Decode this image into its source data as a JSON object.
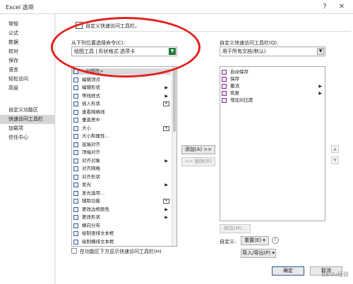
{
  "window": {
    "title": "Excel 选项",
    "help": "?",
    "close": "✕"
  },
  "nav": [
    {
      "label": "常规"
    },
    {
      "label": "公式"
    },
    {
      "label": "数据"
    },
    {
      "label": "校对"
    },
    {
      "label": "保存"
    },
    {
      "label": "语言"
    },
    {
      "label": "轻松访问"
    },
    {
      "label": "高级"
    },
    {
      "label": "自定义功能区"
    },
    {
      "label": "快速访问工具栏"
    },
    {
      "label": "加载项"
    },
    {
      "label": "信任中心"
    }
  ],
  "section": {
    "header": "自定义快速访问工具栏。",
    "choose_label": "从下列位置选择命令(C):",
    "choose_value": "绘图工具 | 形状格式 选项卡",
    "customize_label": "自定义快速访问工具栏(Q):",
    "customize_value": "用于所有文档(默认)"
  },
  "commands": [
    {
      "label": "<分隔符>",
      "icon": "separator-icon"
    },
    {
      "label": "编辑顶点",
      "icon": "edit-points-icon"
    },
    {
      "label": "编辑形状",
      "icon": "edit-shape-icon",
      "arrow": true
    },
    {
      "label": "等线样式",
      "icon": "line-style-icon",
      "arrow": true
    },
    {
      "label": "插入形状",
      "icon": "insert-shape-icon",
      "mini": true
    },
    {
      "label": "查看网格线",
      "icon": "gridlines-icon"
    },
    {
      "label": "垂直居中",
      "icon": "align-middle-icon"
    },
    {
      "label": "大小",
      "icon": "size-icon",
      "mini": true
    },
    {
      "label": "大小和属性...",
      "icon": "size-props-icon"
    },
    {
      "label": "底端对齐",
      "icon": "align-bottom-icon"
    },
    {
      "label": "顶端对齐",
      "icon": "align-top-icon"
    },
    {
      "label": "对齐对象",
      "icon": "align-objects-icon",
      "arrow": true
    },
    {
      "label": "对齐网格",
      "icon": "snap-grid-icon"
    },
    {
      "label": "对齐形状",
      "icon": "snap-shape-icon"
    },
    {
      "label": "发光",
      "icon": "glow-icon",
      "arrow": true
    },
    {
      "label": "发光选项...",
      "icon": "glow-options-icon"
    },
    {
      "label": "辅助功能",
      "icon": "accessibility-icon",
      "mini": true
    },
    {
      "label": "更改边框颜色",
      "icon": "border-color-icon",
      "arrow": true
    },
    {
      "label": "更改形状",
      "icon": "change-shape-icon",
      "arrow": true
    },
    {
      "label": "横向分布",
      "icon": "distribute-h-icon"
    },
    {
      "label": "绘制竖排文本框",
      "icon": "vertical-textbox-icon"
    },
    {
      "label": "绘制横排文本框",
      "icon": "horizontal-textbox-icon"
    }
  ],
  "toolbar_items": [
    {
      "label": "自动保存",
      "icon": "autosave-icon"
    },
    {
      "label": "保存",
      "icon": "save-icon"
    },
    {
      "label": "撤消",
      "icon": "undo-icon",
      "arrow": true
    },
    {
      "label": "恢复",
      "icon": "redo-icon",
      "arrow": true
    },
    {
      "label": "增加对比度",
      "icon": "contrast-icon"
    }
  ],
  "buttons": {
    "add": "添加(A) >>",
    "remove": "<< 删除(R)",
    "modify": "修改(M)...",
    "custom_label": "自定义:",
    "reset": "重置(E)",
    "import_export": "导入/导出(P)",
    "ok": "确定",
    "cancel": "取消",
    "up": "▲",
    "down": "▼"
  },
  "checkbox_label": "在功能区下方显示快速访问工具栏(H)",
  "watermark": "Baidu经验"
}
